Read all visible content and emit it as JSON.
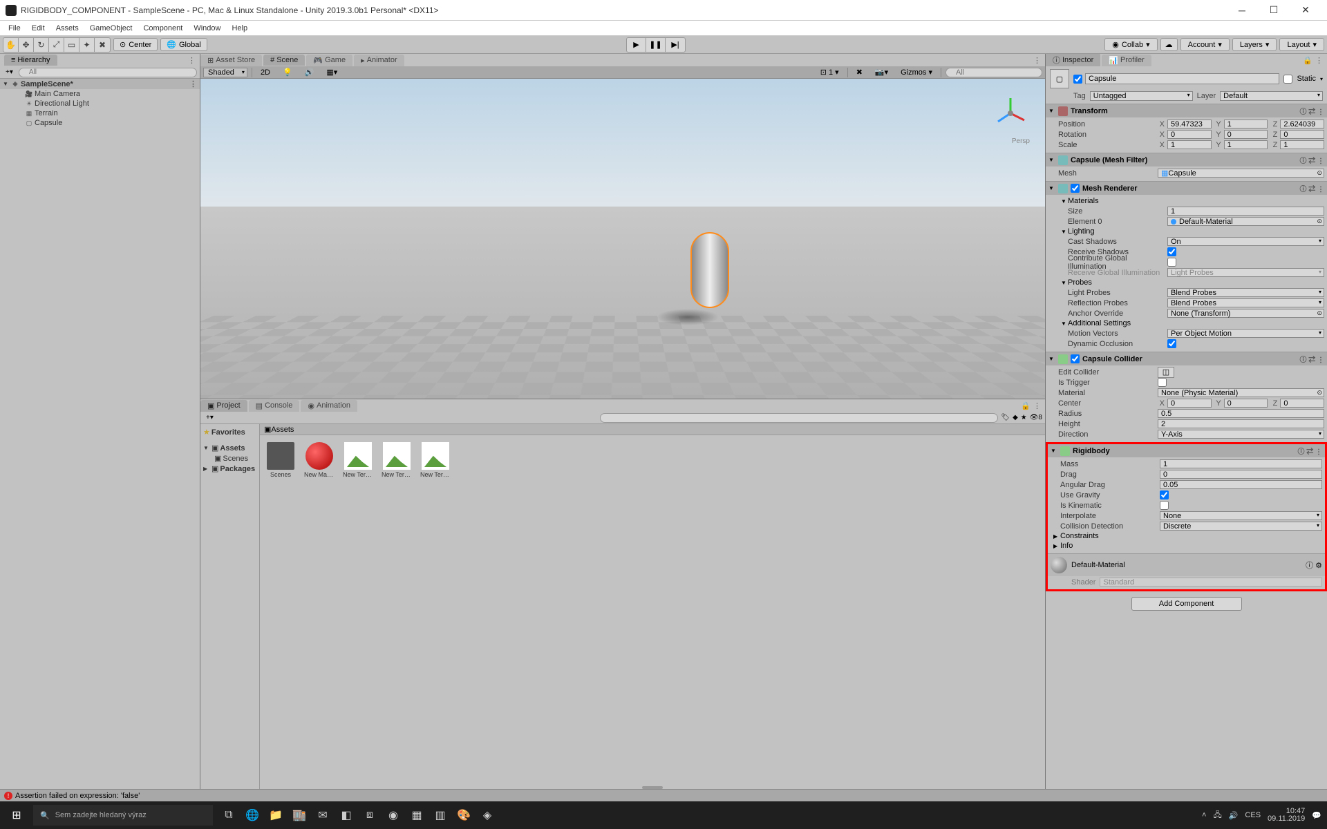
{
  "window": {
    "title": "RIGIDBODY_COMPONENT - SampleScene - PC, Mac & Linux Standalone - Unity 2019.3.0b1 Personal* <DX11>"
  },
  "menubar": [
    "File",
    "Edit",
    "Assets",
    "GameObject",
    "Component",
    "Window",
    "Help"
  ],
  "toolbar": {
    "center": "Center",
    "global": "Global",
    "collab": "Collab",
    "account": "Account",
    "layers": "Layers",
    "layout": "Layout"
  },
  "hierarchy": {
    "title": "Hierarchy",
    "create": "Create",
    "search_placeholder": "All",
    "scene": "SampleScene*",
    "items": [
      "Main Camera",
      "Directional Light",
      "Terrain",
      "Capsule"
    ]
  },
  "scene_tabs": {
    "asset_store": "Asset Store",
    "scene": "Scene",
    "game": "Game",
    "animator": "Animator"
  },
  "scene_bar": {
    "shaded": "Shaded",
    "mode2d": "2D",
    "gizmos": "Gizmos",
    "search_placeholder": "All",
    "persp": "Persp"
  },
  "project": {
    "project": "Project",
    "console": "Console",
    "animation": "Animation",
    "favorites": "Favorites",
    "assets": "Assets",
    "scenes": "Scenes",
    "packages": "Packages",
    "breadcrumb": "Assets",
    "items": [
      "Scenes",
      "New Mater..",
      "New Terra..",
      "New Terra..",
      "New Terra.."
    ]
  },
  "inspector": {
    "tab_inspector": "Inspector",
    "tab_profiler": "Profiler",
    "name": "Capsule",
    "static": "Static",
    "tag_label": "Tag",
    "tag_value": "Untagged",
    "layer_label": "Layer",
    "layer_value": "Default",
    "transform": {
      "title": "Transform",
      "pos": "Position",
      "rot": "Rotation",
      "scale": "Scale",
      "px": "59.47323",
      "py": "1",
      "pz": "2.624039",
      "rx": "0",
      "ry": "0",
      "rz": "0",
      "sx": "1",
      "sy": "1",
      "sz": "1"
    },
    "meshfilter": {
      "title": "Capsule (Mesh Filter)",
      "mesh_label": "Mesh",
      "mesh_value": "Capsule"
    },
    "meshrenderer": {
      "title": "Mesh Renderer",
      "materials": "Materials",
      "size_label": "Size",
      "size_value": "1",
      "elem0_label": "Element 0",
      "elem0_value": "Default-Material",
      "lighting": "Lighting",
      "castshadows_label": "Cast Shadows",
      "castshadows_value": "On",
      "recvshadows_label": "Receive Shadows",
      "contrib_gi": "Contribute Global Illumination",
      "recv_gi_label": "Receive Global Illumination",
      "recv_gi_value": "Light Probes",
      "probes": "Probes",
      "lightprobes_label": "Light Probes",
      "lightprobes_value": "Blend Probes",
      "reflprobes_label": "Reflection Probes",
      "reflprobes_value": "Blend Probes",
      "anchor_label": "Anchor Override",
      "anchor_value": "None (Transform)",
      "addl": "Additional Settings",
      "motion_label": "Motion Vectors",
      "motion_value": "Per Object Motion",
      "dynocc_label": "Dynamic Occlusion"
    },
    "collider": {
      "title": "Capsule Collider",
      "edit_collider": "Edit Collider",
      "istrigger": "Is Trigger",
      "material_label": "Material",
      "material_value": "None (Physic Material)",
      "center_label": "Center",
      "cx": "0",
      "cy": "0",
      "cz": "0",
      "radius_label": "Radius",
      "radius_value": "0.5",
      "height_label": "Height",
      "height_value": "2",
      "direction_label": "Direction",
      "direction_value": "Y-Axis"
    },
    "rigidbody": {
      "title": "Rigidbody",
      "mass_label": "Mass",
      "mass_value": "1",
      "drag_label": "Drag",
      "drag_value": "0",
      "angdrag_label": "Angular Drag",
      "angdrag_value": "0.05",
      "usegravity_label": "Use Gravity",
      "iskinematic_label": "Is Kinematic",
      "interp_label": "Interpolate",
      "interp_value": "None",
      "colldet_label": "Collision Detection",
      "colldet_value": "Discrete",
      "constraints": "Constraints",
      "info": "Info"
    },
    "material_preview": {
      "name": "Default-Material",
      "shader_label": "Shader",
      "shader_value": "Standard"
    },
    "add_component": "Add Component"
  },
  "status": {
    "error": "Assertion failed on expression: 'false'"
  },
  "taskbar": {
    "search_placeholder": "Sem zadejte hledaný výraz",
    "lang": "CES",
    "time": "10:47",
    "date": "09.11.2019"
  }
}
